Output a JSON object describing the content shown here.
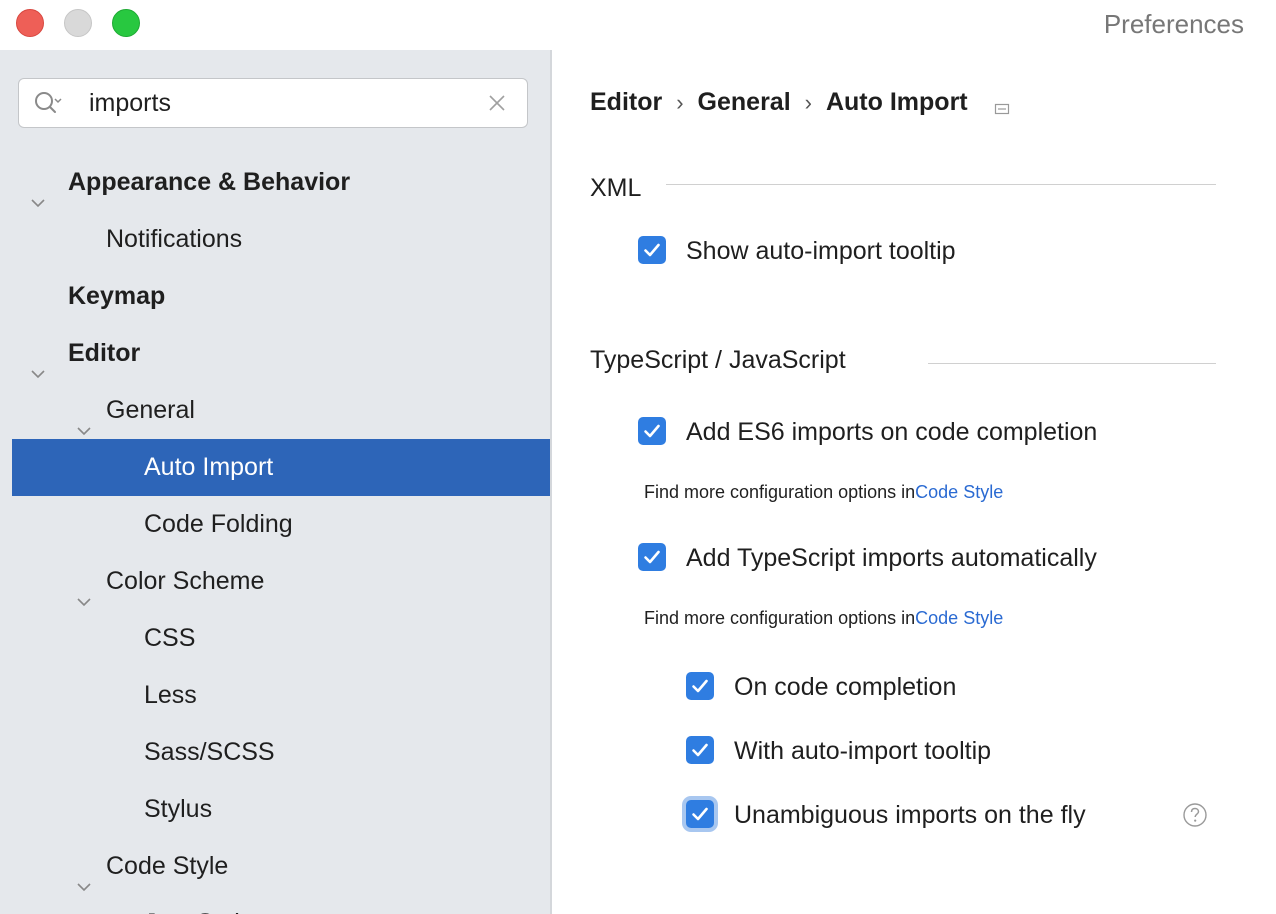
{
  "window": {
    "title": "Preferences"
  },
  "search": {
    "value": "imports",
    "placeholder": ""
  },
  "tree": {
    "items": [
      {
        "label": "Appearance & Behavior"
      },
      {
        "label": "Notifications"
      },
      {
        "label": "Keymap"
      },
      {
        "label": "Editor"
      },
      {
        "label": "General"
      },
      {
        "label": "Auto Import"
      },
      {
        "label": "Code Folding"
      },
      {
        "label": "Color Scheme"
      },
      {
        "label": "CSS"
      },
      {
        "label": "Less"
      },
      {
        "label": "Sass/SCSS"
      },
      {
        "label": "Stylus"
      },
      {
        "label": "Code Style"
      },
      {
        "label": "JavaScript"
      }
    ]
  },
  "breadcrumb": {
    "part1": "Editor",
    "part2": "General",
    "part3": "Auto Import",
    "separator": "›"
  },
  "sections": {
    "xml": {
      "header": "XML",
      "show_tooltip": {
        "label": "Show auto-import tooltip",
        "checked": true
      }
    },
    "ts": {
      "header": "TypeScript / JavaScript",
      "es6_imports": {
        "label": "Add ES6 imports on code completion",
        "checked": true
      },
      "hint1_text": "Find more configuration options in",
      "hint1_link": "Code Style",
      "ts_imports": {
        "label": "Add TypeScript imports automatically",
        "checked": true
      },
      "hint2_text": "Find more configuration options in",
      "hint2_link": "Code Style",
      "on_completion": {
        "label": "On code completion",
        "checked": true
      },
      "with_tooltip": {
        "label": "With auto-import tooltip",
        "checked": true
      },
      "unambiguous": {
        "label": "Unambiguous imports on the fly",
        "checked": true
      }
    }
  },
  "colors": {
    "selection": "#2d65b8",
    "checkbox": "#2f7de1",
    "link": "#2a6ad2",
    "sidebar_bg": "#e5e8ec"
  },
  "icons": {
    "search": "search-icon",
    "clear": "clear-icon",
    "expand": "chevron-down-icon",
    "help": "help-icon",
    "breadcrumb_menu": "menu-icon"
  }
}
